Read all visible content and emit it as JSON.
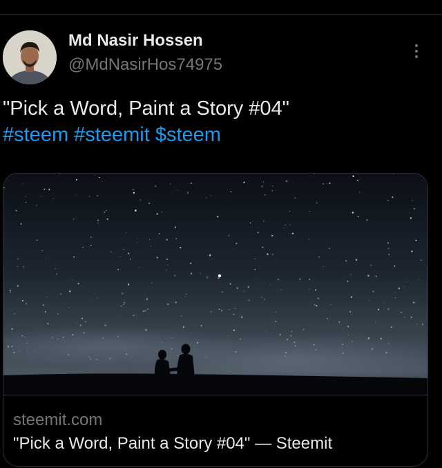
{
  "tweet": {
    "author": {
      "display_name": "Md Nasir Hossen",
      "handle": "@MdNasirHos74975"
    },
    "text": "\"Pick a Word, Paint a Story #04\"",
    "hashtags": [
      "#steem",
      "#steemit",
      "$steem"
    ],
    "link_card": {
      "domain": "steemit.com",
      "title": "\"Pick a Word, Paint a Story #04\" — Steemit"
    }
  },
  "icons": {
    "more": "more-vertical-icon"
  },
  "colors": {
    "background": "#000000",
    "primary_text": "#e7e9ea",
    "secondary_text": "#71767b",
    "link": "#1d9bf0",
    "border": "#2f3336"
  }
}
